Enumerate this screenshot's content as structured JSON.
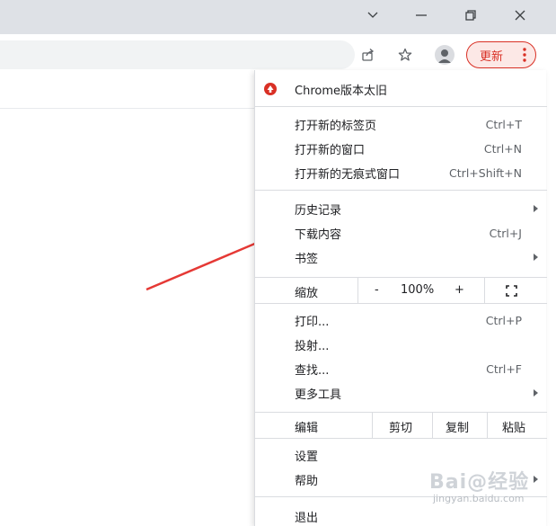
{
  "toolbar": {
    "update_label": "更新"
  },
  "menu": {
    "banner": {
      "label": "Chrome版本太旧"
    },
    "items": [
      {
        "label": "打开新的标签页",
        "shortcut": "Ctrl+T"
      },
      {
        "label": "打开新的窗口",
        "shortcut": "Ctrl+N"
      },
      {
        "label": "打开新的无痕式窗口",
        "shortcut": "Ctrl+Shift+N"
      },
      {
        "label": "历史记录",
        "shortcut": ""
      },
      {
        "label": "下载内容",
        "shortcut": "Ctrl+J"
      },
      {
        "label": "书签",
        "shortcut": ""
      },
      {
        "label": "打印...",
        "shortcut": "Ctrl+P"
      },
      {
        "label": "投射...",
        "shortcut": ""
      },
      {
        "label": "查找...",
        "shortcut": "Ctrl+F"
      },
      {
        "label": "更多工具",
        "shortcut": ""
      },
      {
        "label": "设置",
        "shortcut": ""
      },
      {
        "label": "帮助",
        "shortcut": ""
      },
      {
        "label": "退出",
        "shortcut": ""
      }
    ],
    "zoom": {
      "label": "缩放",
      "minus": "-",
      "value": "100%",
      "plus": "+"
    },
    "edit": {
      "label": "编辑",
      "cut": "剪切",
      "copy": "复制",
      "paste": "粘贴"
    }
  },
  "watermark": {
    "text": "Bai@经验",
    "sub": "jingyan.baidu.com"
  },
  "colors": {
    "update_accent": "#d93025",
    "arrow": "#e53935",
    "banner_icon": "#d93025"
  }
}
